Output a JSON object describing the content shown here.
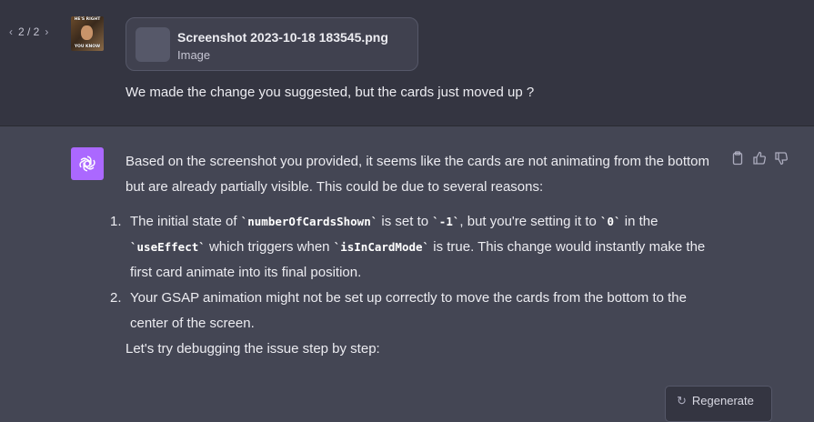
{
  "pager": {
    "prev": "‹",
    "label": "2 / 2",
    "next": "›"
  },
  "user_avatar": {
    "meme_top": "HE'S RIGHT",
    "meme_bottom": "YOU KNOW"
  },
  "attachment": {
    "filename": "Screenshot 2023-10-18 183545.png",
    "type": "Image"
  },
  "user_message": "We made the change you suggested, but the cards just moved up ?",
  "assistant": {
    "intro": "Based on the screenshot you provided, it seems like the cards are not animating from the bottom but are already partially visible. This could be due to several reasons:",
    "items": [
      {
        "num": "1.",
        "parts": [
          "The initial state of ",
          "`numberOfCardsShown`",
          " is set to ",
          "`-1`",
          ", but you're setting it to ",
          "`0`",
          " in the ",
          "`useEffect`",
          " which triggers when ",
          "`isInCardMode`",
          " is true. This change would instantly make the first card animate into its final position."
        ]
      },
      {
        "num": "2.",
        "parts": [
          "Your GSAP animation might not be set up correctly to move the cards from the bottom to the center of the screen."
        ]
      }
    ],
    "debug_text": "Let's try debugging the issue step by step:"
  },
  "actions": {
    "copy": "clipboard-icon",
    "like": "thumbs-up-icon",
    "dislike": "thumbs-down-icon"
  },
  "regenerate": {
    "icon": "↻",
    "label": "Regenerate"
  },
  "colors": {
    "gpt_avatar": "#ab68ff",
    "user_bg": "#343541",
    "assistant_bg": "#444654"
  }
}
